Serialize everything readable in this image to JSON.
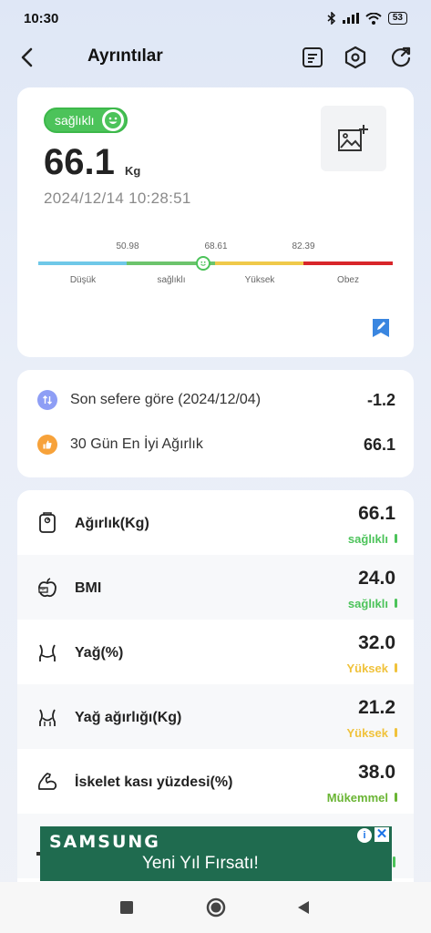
{
  "status_bar": {
    "time": "10:30",
    "battery": "53"
  },
  "header": {
    "title": "Ayrıntılar"
  },
  "summary": {
    "status_label": "sağlıklı",
    "weight": "66.1",
    "unit": "Kg",
    "timestamp": "2024/12/14 10:28:51",
    "range": {
      "thresholds": [
        "50.98",
        "68.61",
        "82.39"
      ],
      "categories": [
        "Düşük",
        "sağlıklı",
        "Yüksek",
        "Obez"
      ],
      "colors": [
        "#6fc8e8",
        "#6cc46c",
        "#f0c94a",
        "#d8262a"
      ]
    }
  },
  "comparison": [
    {
      "label": "Son sefere göre (2024/12/04)",
      "value": "-1.2",
      "icon": "arrows-updown-icon",
      "color": "#8e9ef5"
    },
    {
      "label": "30 Gün En İyi Ağırlık",
      "value": "66.1",
      "icon": "thumbs-up-icon",
      "color": "#f7a23a"
    }
  ],
  "metrics": [
    {
      "label": "Ağırlık(Kg)",
      "value": "66.1",
      "status": "sağlıklı",
      "status_color": "#4cc35a",
      "icon": "scale-icon"
    },
    {
      "label": "BMI",
      "value": "24.0",
      "status": "sağlıklı",
      "status_color": "#4cc35a",
      "icon": "apple-icon"
    },
    {
      "label": "Yağ(%)",
      "value": "32.0",
      "status": "Yüksek",
      "status_color": "#f0c23b",
      "icon": "waist-icon"
    },
    {
      "label": "Yağ ağırlığı(Kg)",
      "value": "21.2",
      "status": "Yüksek",
      "status_color": "#f0c23b",
      "icon": "body-fat-icon"
    },
    {
      "label": "İskelet kası yüzdesi(%)",
      "value": "38.0",
      "status": "Mükemmel",
      "status_color": "#6ab534",
      "icon": "muscle-icon"
    }
  ],
  "ad": {
    "brand": "SAMSUNG",
    "text": "Yeni Yıl Fırsatı!"
  }
}
